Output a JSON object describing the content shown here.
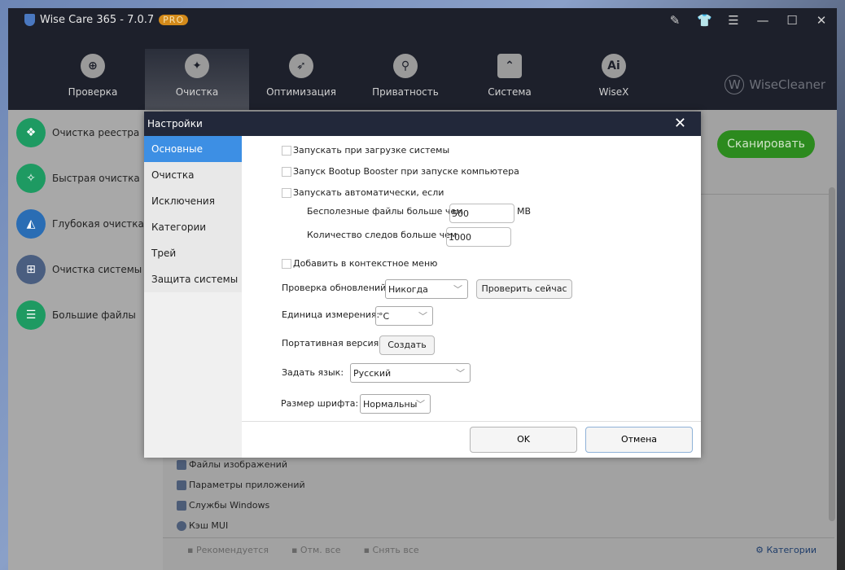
{
  "app": {
    "title": "Wise Care 365 - 7.0.7",
    "badge": "PRO",
    "brand": "WiseCleaner",
    "brand_mark": "W"
  },
  "window_controls": [
    "feedback-icon",
    "skin-icon",
    "menu-icon",
    "minimize-icon",
    "maximize-icon",
    "close-icon"
  ],
  "nav": [
    {
      "label": "Проверка",
      "icon": "target-icon"
    },
    {
      "label": "Очистка",
      "icon": "broom-icon",
      "active": true
    },
    {
      "label": "Оптимизация",
      "icon": "rocket-icon"
    },
    {
      "label": "Приватность",
      "icon": "shield-lock-icon"
    },
    {
      "label": "Система",
      "icon": "monitor-icon"
    },
    {
      "label": "WiseX",
      "icon": "ai-icon"
    }
  ],
  "sidebar": [
    {
      "label": "Очистка реестра",
      "color": "#1e9a62"
    },
    {
      "label": "Быстрая очистка",
      "color": "#1e9a62"
    },
    {
      "label": "Глубокая очистка",
      "color": "#2a6db4"
    },
    {
      "label": "Очистка системы",
      "color": "#4a5e80"
    },
    {
      "label": "Большие файлы",
      "color": "#1e9a62"
    }
  ],
  "scan_label": "Сканировать",
  "categories_list": [
    "Файлы изображений",
    "Параметры приложений",
    "Службы Windows",
    "Кэш MUI"
  ],
  "bottom": {
    "recommended": "Рекомендуется",
    "select_all": "Отм. все",
    "deselect_all": "Снять все",
    "categories": "Категории"
  },
  "dialog": {
    "title": "Настройки",
    "nav": [
      "Основные",
      "Очистка",
      "Исключения",
      "Категории",
      "Трей",
      "Защита системы"
    ],
    "options": {
      "autostart": {
        "label": "Запускать при загрузке системы",
        "checked": false
      },
      "bootup": {
        "label": "Запуск Bootup Booster при запуске компьютера",
        "checked": false
      },
      "auto_run": {
        "label": "Запускать автоматически, если",
        "checked": false
      },
      "junk_label": "Бесполезные файлы больше чем",
      "junk_value": "500",
      "junk_unit": "MB",
      "traces_label": "Количество следов больше чем",
      "traces_value": "1000",
      "context_menu": {
        "label": "Добавить в контекстное меню",
        "checked": false
      },
      "update_label": "Проверка обновлений",
      "update_value": "Никогда",
      "check_now": "Проверить сейчас",
      "unit_label": "Единица измерения:",
      "unit_value": "°C",
      "portable_label": "Портативная версия",
      "create": "Создать",
      "lang_label": "Задать язык:",
      "lang_value": "Русский",
      "font_label": "Размер шрифта:",
      "font_value": "Нормальны"
    },
    "ok": "OK",
    "cancel": "Отмена"
  }
}
